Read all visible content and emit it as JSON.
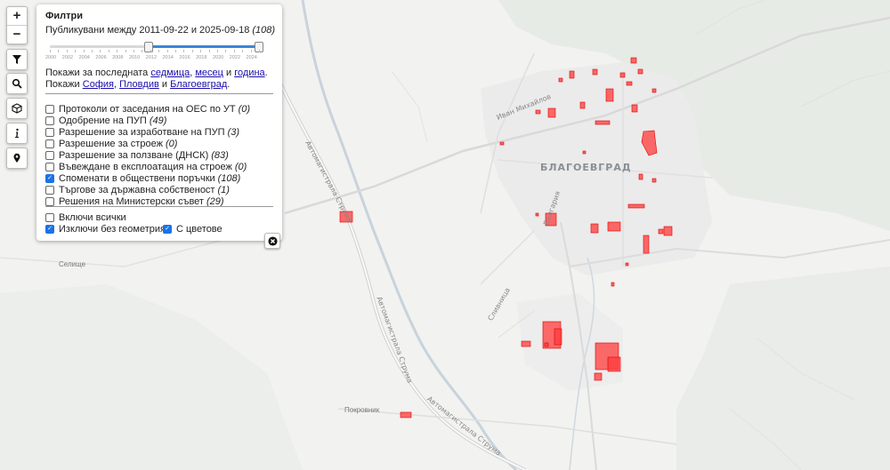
{
  "map": {
    "city": "БЛАГОЕВГРАД",
    "villages": {
      "selishte": "Селище",
      "pokrovnik": "Покровник"
    },
    "roads": {
      "highway": "Автомагистрала Струма",
      "ivan_mihaylov": "Иван Михайлов",
      "bulgaria": "България",
      "slivnitsa": "Сливница"
    },
    "colors": {
      "plot_fill": "#ff3b3b",
      "plot_dark": "#d90000",
      "river": "#c8d3dc",
      "road": "#d6d6d6"
    }
  },
  "controls": {
    "zoom_in": "+",
    "zoom_out": "−",
    "tools": [
      "filter-icon",
      "search-icon",
      "cube-icon",
      "info-icon",
      "location-pin-icon"
    ]
  },
  "filters": {
    "title": "Филтри",
    "published_prefix": "Публикувани между 2011-09-22 и 2025-09-18",
    "published_count": "(108)",
    "slider": {
      "min_year": 2000,
      "max_year": 2025,
      "from_year": 2011.7,
      "to_year": 2025
    },
    "slider_ticks": [
      "2000",
      "2002",
      "2004",
      "2006",
      "2008",
      "2010",
      "2012",
      "2014",
      "2016",
      "2018",
      "2020",
      "2022",
      "2024"
    ],
    "quick": {
      "line1_prefix": "Покажи за последната",
      "week": "седмица",
      "month": "месец",
      "and": "и",
      "year": "година",
      "line2_prefix": "Покажи",
      "sofia": "София",
      "plovdiv": "Пловдив",
      "blagoevgrad": "Благоевград"
    },
    "categories": [
      {
        "label": "Протоколи от заседания на ОЕС по УТ",
        "count": "(0)",
        "checked": false
      },
      {
        "label": "Одобрение на ПУП",
        "count": "(49)",
        "checked": false
      },
      {
        "label": "Разрешение за изработване на ПУП",
        "count": "(3)",
        "checked": false
      },
      {
        "label": "Разрешение за строеж",
        "count": "(0)",
        "checked": false
      },
      {
        "label": "Разрешение за ползване (ДНСК)",
        "count": "(83)",
        "checked": false
      },
      {
        "label": "Въвеждане в експлоатация на строеж",
        "count": "(0)",
        "checked": false
      },
      {
        "label": "Споменати в обществени поръчки",
        "count": "(108)",
        "checked": true
      },
      {
        "label": "Търгове за държавна собственост",
        "count": "(1)",
        "checked": false
      },
      {
        "label": "Решения на Министерски съвет",
        "count": "(29)",
        "checked": false
      }
    ],
    "options": {
      "include_all": {
        "label": "Включи всички",
        "checked": false
      },
      "exclude_no_geometry": {
        "label": "Изключи без геометрия",
        "checked": true
      },
      "with_colors": {
        "label": "С цветове",
        "checked": true
      }
    }
  }
}
